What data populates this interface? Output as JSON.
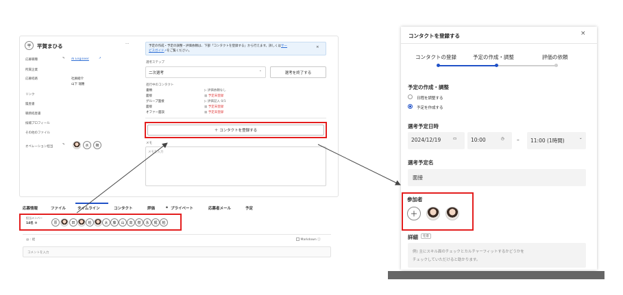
{
  "left": {
    "profile": {
      "avatar_letter": "平",
      "name": "平賀まひる",
      "more": "···",
      "rows": [
        {
          "label": "応募職種",
          "value": "AI Engineer",
          "extra": ""
        },
        {
          "label": "所属企業",
          "value": "",
          "extra": ""
        },
        {
          "label": "応募経路",
          "value": "社員紹介",
          "extra": "山下 瑞穂"
        },
        {
          "label": "リンク",
          "value": "",
          "extra": ""
        },
        {
          "label": "履歴書",
          "value": "",
          "extra": ""
        },
        {
          "label": "職務経歴書",
          "value": "",
          "extra": ""
        },
        {
          "label": "候補プロフィール",
          "value": "",
          "extra": ""
        },
        {
          "label": "その他のファイル",
          "value": "",
          "extra": ""
        },
        {
          "label": "オペレーション担当",
          "value": "",
          "extra": ""
        }
      ],
      "operators": [
        "水",
        "穣"
      ]
    },
    "notice": {
      "line1": "予定の作成・予定の調整・評価依頼は、下部「コンタクトを登録する」から行えます。詳しくは",
      "link1": "サー",
      "link2": "ビスガイド",
      "line2": "をご覧ください。",
      "close": "×"
    },
    "step_label": "選考ステップ",
    "step_value": "二次選考",
    "finish_button": "選考を終了する",
    "contacts_label": "進行中のコンタクト",
    "contacts": [
      {
        "name": "書類",
        "status": "評価依頼なし",
        "color": "#666666"
      },
      {
        "name": "面接",
        "status": "予定未登録",
        "color": "#e03a3a"
      },
      {
        "name": "グループ面接",
        "status": "評価記入 0/1",
        "color": "#666666"
      },
      {
        "name": "面接",
        "status": "予定未登録",
        "color": "#e03a3a"
      },
      {
        "name": "オファー面談",
        "status": "予定未登録",
        "color": "#e03a3a"
      }
    ],
    "register_button": "＋ コンタクトを登録する",
    "memo_label": "メモ",
    "memo_placeholder": "メモを入力",
    "tabs": [
      "応募情報",
      "ファイル",
      "タイムライン",
      "コンタクト",
      "評価",
      "プライベート",
      "応募者メール",
      "予定"
    ],
    "members_label": "担当メンバー",
    "members_count": "14名",
    "members": [
      "原",
      "田",
      "柏",
      "太",
      "藤",
      "山",
      "高",
      "樹",
      "永",
      "梶",
      "柏"
    ],
    "mention_hint": "@ : 絵",
    "markdown_label": "Markdown",
    "comment_placeholder": "コメントを入力"
  },
  "modal": {
    "title": "コンタクトを登録する",
    "close": "×",
    "steps": [
      "コンタクトの登録",
      "予定の作成・調整",
      "評価の依頼"
    ],
    "section_title": "予定の作成・調整",
    "options": [
      "日程を調整する",
      "予定を作成する"
    ],
    "datetime_label": "選考予定日時",
    "date": "2024/12/19",
    "start_time": "10:00",
    "dash": "–",
    "end_time": "11:00 (1時間)",
    "name_label": "選考予定名",
    "name_value": "面接",
    "participants_label": "参加者",
    "add": "＋",
    "details_label": "詳細",
    "optional_tag": "任意",
    "details_placeholder_1": "例) 主にスキル面のチェックとカルチャーフィットするかどうかを",
    "details_placeholder_2": "チェックしていただけると助かります。"
  },
  "colors": {
    "accent": "#1f50c7",
    "highlight": "#e31c1c",
    "link": "#2b6cd4"
  }
}
